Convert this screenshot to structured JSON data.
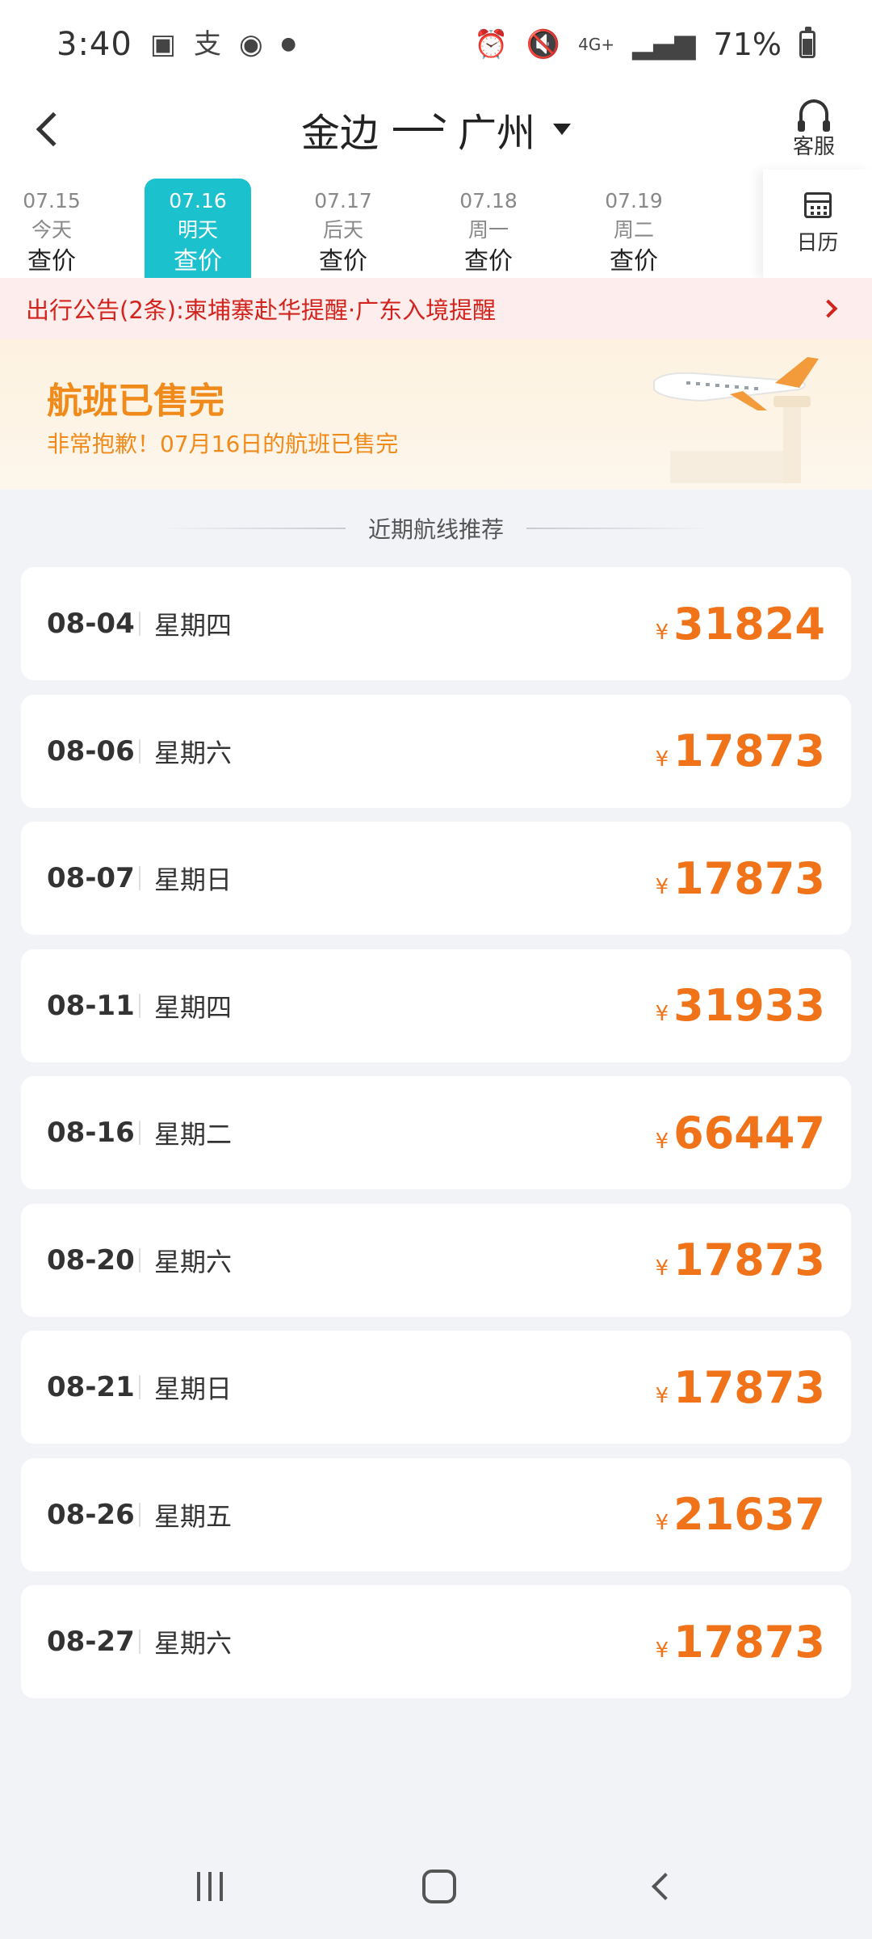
{
  "status_bar": {
    "time": "3:40",
    "network": "4G+",
    "battery": "71%",
    "battery_level": 0.71
  },
  "header": {
    "origin": "金边",
    "destination": "广州",
    "service_label": "客服"
  },
  "date_strip": {
    "dates": [
      {
        "date": "07.15",
        "weekday": "今天",
        "price": "查价",
        "active": false
      },
      {
        "date": "07.16",
        "weekday": "明天",
        "price": "查价",
        "active": true
      },
      {
        "date": "07.17",
        "weekday": "后天",
        "price": "查价",
        "active": false
      },
      {
        "date": "07.18",
        "weekday": "周一",
        "price": "查价",
        "active": false
      },
      {
        "date": "07.19",
        "weekday": "周二",
        "price": "查价",
        "active": false
      }
    ],
    "calendar_label": "日历"
  },
  "notice": {
    "text": "出行公告(2条):柬埔寨赴华提醒·广东入境提醒"
  },
  "soldout": {
    "title": "航班已售完",
    "subtitle": "非常抱歉！07月16日的航班已售完"
  },
  "recommend": {
    "title": "近期航线推荐",
    "currency": "¥",
    "flights": [
      {
        "date": "08-04",
        "weekday": "星期四",
        "price": "31824"
      },
      {
        "date": "08-06",
        "weekday": "星期六",
        "price": "17873"
      },
      {
        "date": "08-07",
        "weekday": "星期日",
        "price": "17873"
      },
      {
        "date": "08-11",
        "weekday": "星期四",
        "price": "31933"
      },
      {
        "date": "08-16",
        "weekday": "星期二",
        "price": "66447"
      },
      {
        "date": "08-20",
        "weekday": "星期六",
        "price": "17873"
      },
      {
        "date": "08-21",
        "weekday": "星期日",
        "price": "17873"
      },
      {
        "date": "08-26",
        "weekday": "星期五",
        "price": "21637"
      },
      {
        "date": "08-27",
        "weekday": "星期六",
        "price": "17873"
      }
    ]
  },
  "colors": {
    "accent": "#1bc1cd",
    "price": "#f0731a",
    "notice": "#d2231d",
    "soldout": "#f08a1a"
  }
}
